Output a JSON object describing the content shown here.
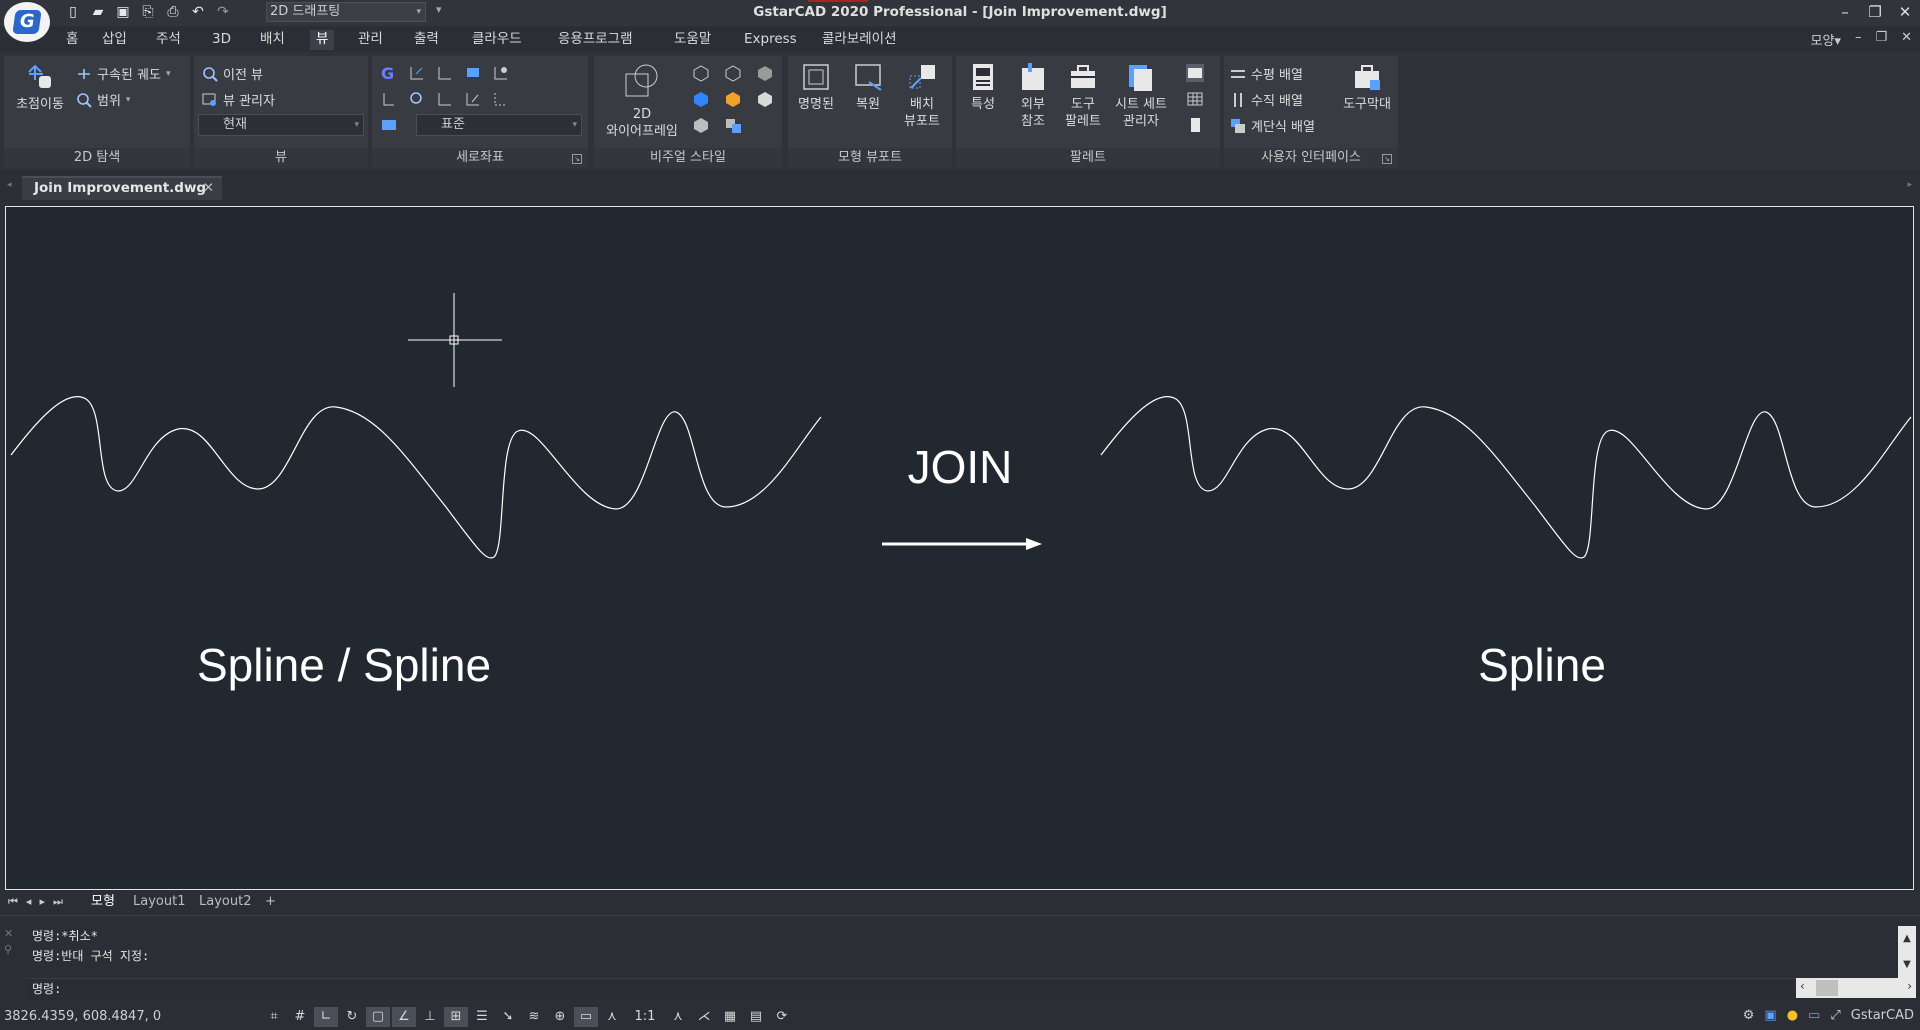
{
  "title_bar": {
    "title": "GstarCAD 2020 Professional - [Join Improvement.dwg]",
    "workspace": "2D 드래프팅",
    "logo_letter": "G"
  },
  "menu": {
    "tabs": [
      "홈",
      "삽입",
      "주석",
      "3D",
      "배치",
      "뷰",
      "관리",
      "출력",
      "클라우드",
      "응용프로그램",
      "도움말",
      "Express",
      "콜라보레이션"
    ],
    "active_tab": "뷰",
    "right_label": "모양"
  },
  "ribbon": {
    "nav2d": {
      "title": "2D 탐색",
      "pan": "초점이동",
      "orbit": "구속된 궤도",
      "range": "범위"
    },
    "view": {
      "title": "뷰",
      "prev_view": "이전 뷰",
      "view_manager": "뷰 관리자",
      "current": "현재"
    },
    "ucs": {
      "title": "세로좌표",
      "standard": "표준"
    },
    "visual_styles": {
      "title": "비주얼 스타일",
      "wireframe_line1": "2D",
      "wireframe_line2": "와이어프레임"
    },
    "model_viewports": {
      "title": "모형 뷰포트",
      "named": "명명된",
      "restore": "복원",
      "layout_line1": "배치",
      "layout_line2": "뷰포트"
    },
    "palettes": {
      "title": "팔레트",
      "properties": "특성",
      "xref_line1": "외부",
      "xref_line2": "참조",
      "tool_line1": "도구",
      "tool_line2": "팔레트",
      "sheetset_line1": "시트 세트",
      "sheetset_line2": "관리자"
    },
    "ui": {
      "title": "사용자 인터페이스",
      "tile_h": "수평 배열",
      "tile_v": "수직 배열",
      "cascade": "계단식 배열",
      "toolbars": "도구막대"
    }
  },
  "document_tab": "Join Improvement.dwg",
  "drawing": {
    "left_label": "Spline / Spline",
    "center_label": "JOIN",
    "right_label": "Spline"
  },
  "layout_tabs": [
    "모형",
    "Layout1",
    "Layout2",
    "+"
  ],
  "command": {
    "history": [
      "명령:*취소*",
      "명령:반대 구석 지정:"
    ],
    "prompt": "명령:"
  },
  "status": {
    "coordinates": "3826.4359, 608.4847, 0",
    "scale": "1:1",
    "app_name": "GstarCAD"
  },
  "colors": {
    "canvas_bg": "#212830",
    "ui_bg": "#2b2e34",
    "panel_bg": "#383b42",
    "accent_blue": "#2a67c9",
    "drawing_line": "#ffffff"
  }
}
